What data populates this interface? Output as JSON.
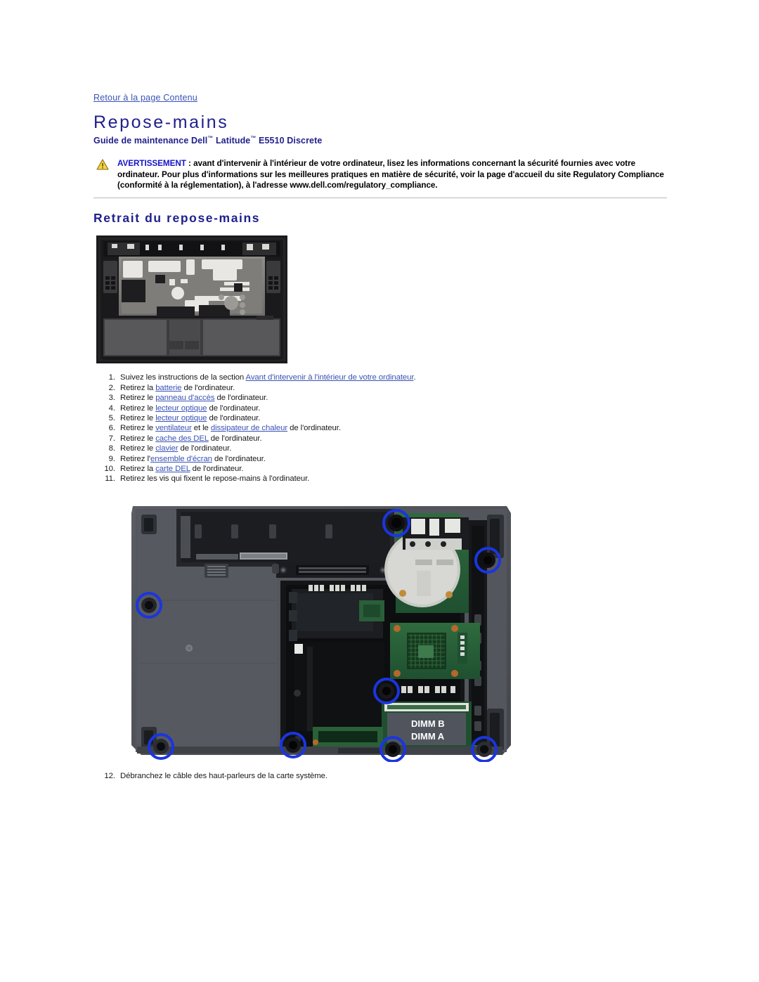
{
  "page": {
    "back_link": "Retour à la page Contenu",
    "title": "Repose-mains",
    "subtitle_prefix": "Guide de maintenance Dell",
    "subtitle_tm1": "™",
    "subtitle_mid": " Latitude",
    "subtitle_tm2": "™",
    "subtitle_suffix": " E5510 Discrete"
  },
  "warning": {
    "icon": "warning-triangle-icon",
    "label": "AVERTISSEMENT",
    "body": " : avant d'intervenir à l'intérieur de votre ordinateur, lisez les informations concernant la sécurité fournies avec votre ordinateur. Pour plus d'informations sur les meilleures pratiques en matière de sécurité, voir la page d'accueil du site Regulatory Compliance (conformité à la réglementation), à l'adresse www.dell.com/regulatory_compliance."
  },
  "section": {
    "heading": "Retrait du repose-mains"
  },
  "figure1": {
    "name": "palm-rest-photo",
    "alt": "Vue du repose-mains retiré du châssis"
  },
  "figure2": {
    "name": "laptop-base-screws-photo",
    "alt": "Base de l'ordinateur avec les vis du repose-mains entourées",
    "labels": {
      "dimm_b": "DIMM  B",
      "dimm_a": "DIMM  A"
    },
    "screw_highlight_color": "#1a35e0",
    "screw_count": 8
  },
  "steps": [
    {
      "num": "1.",
      "pre": "Suivez les instructions de la section ",
      "link": "Avant d'intervenir à l'intérieur de votre ordinateur",
      "post": "."
    },
    {
      "num": "2.",
      "pre": "Retirez la ",
      "link": "batterie",
      "post": " de l'ordinateur."
    },
    {
      "num": "3.",
      "pre": "Retirez le ",
      "link": "panneau d'accès",
      "post": " de l'ordinateur."
    },
    {
      "num": "4.",
      "pre": "Retirez le ",
      "link": "lecteur optique",
      "post": " de l'ordinateur."
    },
    {
      "num": "5.",
      "pre": "Retirez le ",
      "link": "lecteur optique",
      "post": " de l'ordinateur."
    },
    {
      "num": "6.",
      "pre": "Retirez le ",
      "link": "ventilateur",
      "mid": " et le ",
      "link2": "dissipateur de chaleur",
      "post": " de l'ordinateur."
    },
    {
      "num": "7.",
      "pre": "Retirez le ",
      "link": "cache des DEL",
      "post": " de l'ordinateur."
    },
    {
      "num": "8.",
      "pre": "Retirez le ",
      "link": "clavier",
      "post": " de l'ordinateur."
    },
    {
      "num": "9.",
      "pre": "Retirez l'",
      "link": "ensemble d'écran",
      "post": " de l'ordinateur."
    },
    {
      "num": "10.",
      "pre": "Retirez la ",
      "link": "carte DEL",
      "post": " de l'ordinateur."
    },
    {
      "num": "11.",
      "pre": "Retirez les vis qui fixent le repose-mains à l'ordinateur.",
      "link": "",
      "post": ""
    }
  ],
  "final_step": {
    "num": "12.",
    "text": "Débranchez le câble des haut-parleurs de la carte système."
  }
}
